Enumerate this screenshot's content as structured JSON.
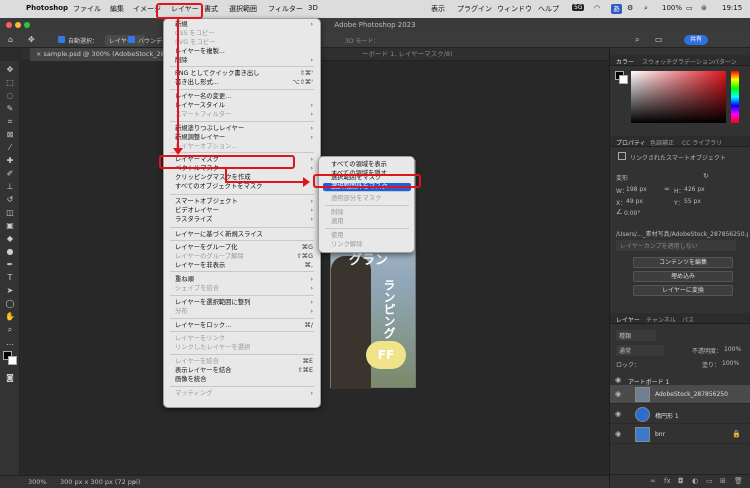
{
  "menubar": {
    "app": "Photoshop",
    "items": [
      "ファイル",
      "編集",
      "イメージ",
      "レイヤー",
      "書式",
      "選択範囲",
      "フィルター",
      "3D",
      "表示",
      "プラグイン",
      "ウィンドウ",
      "ヘルプ"
    ],
    "badge": "5G",
    "input_indicator": "あ",
    "battery": "100%",
    "clock": "19:15"
  },
  "window_title": "Adobe Photoshop 2023",
  "options": {
    "auto_select": "自動選択：",
    "target": "レイヤー",
    "bounding": "バウンディ",
    "share": "共有",
    "mode_3d": "3D モード："
  },
  "document_tab": "sample.psd @ 300% (AdobeStock_287856250",
  "document_tab_right": "ーボード 1, レイヤーマスク/8)",
  "status": {
    "zoom": "300%",
    "size": "300 px x 300 px (72 ppi)"
  },
  "artwork": {
    "line1": "グラン",
    "line2": "ランピング",
    "badge": "FF"
  },
  "layer_menu": {
    "items": [
      {
        "label": "新規",
        "shortcut": "",
        "arrow": "›",
        "disabled": false
      },
      {
        "label": "CSS をコピー",
        "shortcut": "",
        "arrow": "",
        "disabled": true
      },
      {
        "label": "SVG をコピー",
        "shortcut": "",
        "arrow": "",
        "disabled": true
      },
      {
        "label": "レイヤーを複製...",
        "shortcut": "",
        "arrow": "",
        "disabled": false
      },
      {
        "label": "削除",
        "shortcut": "",
        "arrow": "›",
        "disabled": false
      },
      {
        "label": "PNG としてクイック書き出し",
        "shortcut": "⇧⌘'",
        "arrow": "",
        "disabled": false
      },
      {
        "label": "書き出し形式...",
        "shortcut": "⌥⇧⌘'",
        "arrow": "",
        "disabled": false
      },
      {
        "label": "レイヤー名の変更...",
        "shortcut": "",
        "arrow": "",
        "disabled": false
      },
      {
        "label": "レイヤースタイル",
        "shortcut": "",
        "arrow": "›",
        "disabled": false
      },
      {
        "label": "スマートフィルター",
        "shortcut": "",
        "arrow": "›",
        "disabled": true
      },
      {
        "label": "新規塗りつぶしレイヤー",
        "shortcut": "",
        "arrow": "›",
        "disabled": false
      },
      {
        "label": "新規調整レイヤー",
        "shortcut": "",
        "arrow": "›",
        "disabled": false
      },
      {
        "label": "レイヤーオプション...",
        "shortcut": "",
        "arrow": "",
        "disabled": true
      },
      {
        "label": "レイヤーマスク",
        "shortcut": "",
        "arrow": "›",
        "disabled": false
      },
      {
        "label": "ベクトルマスク",
        "shortcut": "",
        "arrow": "›",
        "disabled": false
      },
      {
        "label": "クリッピングマスクを作成",
        "shortcut": "",
        "arrow": "",
        "disabled": false
      },
      {
        "label": "すべてのオブジェクトをマスク",
        "shortcut": "",
        "arrow": "",
        "disabled": false
      },
      {
        "label": "スマートオブジェクト",
        "shortcut": "",
        "arrow": "›",
        "disabled": false
      },
      {
        "label": "ビデオレイヤー",
        "shortcut": "",
        "arrow": "›",
        "disabled": false
      },
      {
        "label": "ラスタライズ",
        "shortcut": "",
        "arrow": "›",
        "disabled": false
      },
      {
        "label": "レイヤーに基づく新規スライス",
        "shortcut": "",
        "arrow": "",
        "disabled": false
      },
      {
        "label": "レイヤーをグループ化",
        "shortcut": "⌘G",
        "arrow": "",
        "disabled": false
      },
      {
        "label": "レイヤーのグループ解除",
        "shortcut": "⇧⌘G",
        "arrow": "",
        "disabled": true
      },
      {
        "label": "レイヤーを非表示",
        "shortcut": "⌘,",
        "arrow": "",
        "disabled": false
      },
      {
        "label": "重ね順",
        "shortcut": "",
        "arrow": "›",
        "disabled": false
      },
      {
        "label": "シェイプを結合",
        "shortcut": "",
        "arrow": "›",
        "disabled": true
      },
      {
        "label": "レイヤーを選択範囲に整列",
        "shortcut": "",
        "arrow": "›",
        "disabled": false
      },
      {
        "label": "分布",
        "shortcut": "",
        "arrow": "›",
        "disabled": true
      },
      {
        "label": "レイヤーをロック...",
        "shortcut": "⌘/",
        "arrow": "",
        "disabled": false
      },
      {
        "label": "レイヤーをリンク",
        "shortcut": "",
        "arrow": "",
        "disabled": true
      },
      {
        "label": "リンクしたレイヤーを選択",
        "shortcut": "",
        "arrow": "",
        "disabled": true
      },
      {
        "label": "レイヤーを結合",
        "shortcut": "⌘E",
        "arrow": "",
        "disabled": true
      },
      {
        "label": "表示レイヤーを結合",
        "shortcut": "⇧⌘E",
        "arrow": "",
        "disabled": false
      },
      {
        "label": "画像を統合",
        "shortcut": "",
        "arrow": "",
        "disabled": false
      },
      {
        "label": "マッティング",
        "shortcut": "",
        "arrow": "›",
        "disabled": true
      }
    ]
  },
  "mask_submenu": {
    "items": [
      {
        "label": "すべての領域を表示",
        "disabled": false
      },
      {
        "label": "すべての領域を隠す",
        "disabled": false
      },
      {
        "label": "選択範囲をマスク",
        "disabled": false
      },
      {
        "label": "選択範囲外をマスク",
        "disabled": false
      },
      {
        "label": "透明部分をマスク",
        "disabled": true
      },
      {
        "label": "削除",
        "disabled": true
      },
      {
        "label": "適用",
        "disabled": true
      },
      {
        "label": "使用",
        "disabled": true
      },
      {
        "label": "リンク解除",
        "disabled": true
      }
    ]
  },
  "color_panel": {
    "tabs": [
      "カラー",
      "スウォッチ",
      "グラデーション",
      "パターン"
    ]
  },
  "properties_panel": {
    "tabs": [
      "プロパティ",
      "色調補正",
      "CC ライブラリ"
    ],
    "kind": "リンクされたスマートオブジェクト",
    "section": "変形",
    "w_label": "W：",
    "w_value": "198 px",
    "h_label": "H：",
    "h_value": "426 px",
    "x_label": "X：",
    "x_value": "49 px",
    "y_label": "Y：",
    "y_value": "55 px",
    "angle": "0.00°",
    "path": "/Users/..._素材写真/AdobeStock_287856250.psd",
    "comp": "レイヤーカンプを適用しない",
    "btn_edit": "コンテンツを編集",
    "btn_embed": "埋め込み",
    "btn_convert": "レイヤーに変換"
  },
  "layers_panel": {
    "tabs": [
      "レイヤー",
      "チャンネル",
      "パス"
    ],
    "filter": "種類",
    "blend": "通常",
    "opacity_label": "不透明度：",
    "opacity": "100%",
    "lock_label": "ロック：",
    "fill_label": "塗り：",
    "fill": "100%",
    "artboard": "アートボード 1",
    "layers": [
      "AdobeStock_287856250",
      "楕円形 1",
      "bnr"
    ]
  }
}
